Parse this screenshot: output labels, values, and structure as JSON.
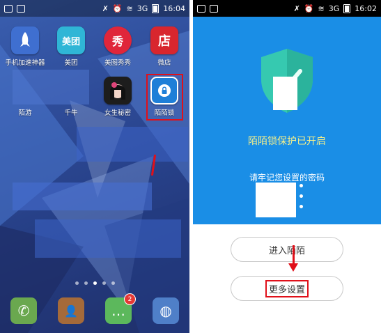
{
  "left_screen": {
    "status": {
      "time": "16:04",
      "signal": "3G"
    },
    "apps": [
      {
        "label": "手机加速神器",
        "icon": "rocket-icon",
        "color": "#3f6fd0"
      },
      {
        "label": "美团",
        "icon": "meituan-icon",
        "color": "#2fb6d6",
        "text": "美团"
      },
      {
        "label": "美图秀秀",
        "icon": "meitu-icon",
        "color": "#e0263a",
        "text": "秀"
      },
      {
        "label": "微店",
        "icon": "weidian-icon",
        "color": "#d8262e",
        "text": "店"
      },
      {
        "label": "陌游",
        "icon": "moyou-icon",
        "color": "#4a6fc0"
      },
      {
        "label": "千牛",
        "icon": "qianniu-icon",
        "color": "#4a6fc0"
      },
      {
        "label": "女生秘密",
        "icon": "girl-icon",
        "color": "#1d1d1d"
      },
      {
        "label": "陌陌锁",
        "icon": "lock-icon",
        "color": "#1e7fd8"
      }
    ],
    "dock": [
      {
        "icon": "phone-icon",
        "color": "#6aa84f",
        "glyph": "✆"
      },
      {
        "icon": "contacts-icon",
        "color": "#a56a3a",
        "glyph": "👤"
      },
      {
        "icon": "messages-icon",
        "color": "#5cb85c",
        "glyph": "…",
        "badge": "2"
      },
      {
        "icon": "browser-icon",
        "color": "#4f7fc8",
        "glyph": "◍"
      }
    ],
    "page_dots": 5,
    "active_dot": 2
  },
  "right_screen": {
    "status": {
      "time": "16:02",
      "signal": "3G"
    },
    "protected_title": "陌陌锁保护已开启",
    "password_hint": "请牢记您设置的密码",
    "enter_button": "进入陌陌",
    "settings_button": "更多设置",
    "accent_color": "#1a8ee6",
    "title_color": "#f6f08a"
  }
}
